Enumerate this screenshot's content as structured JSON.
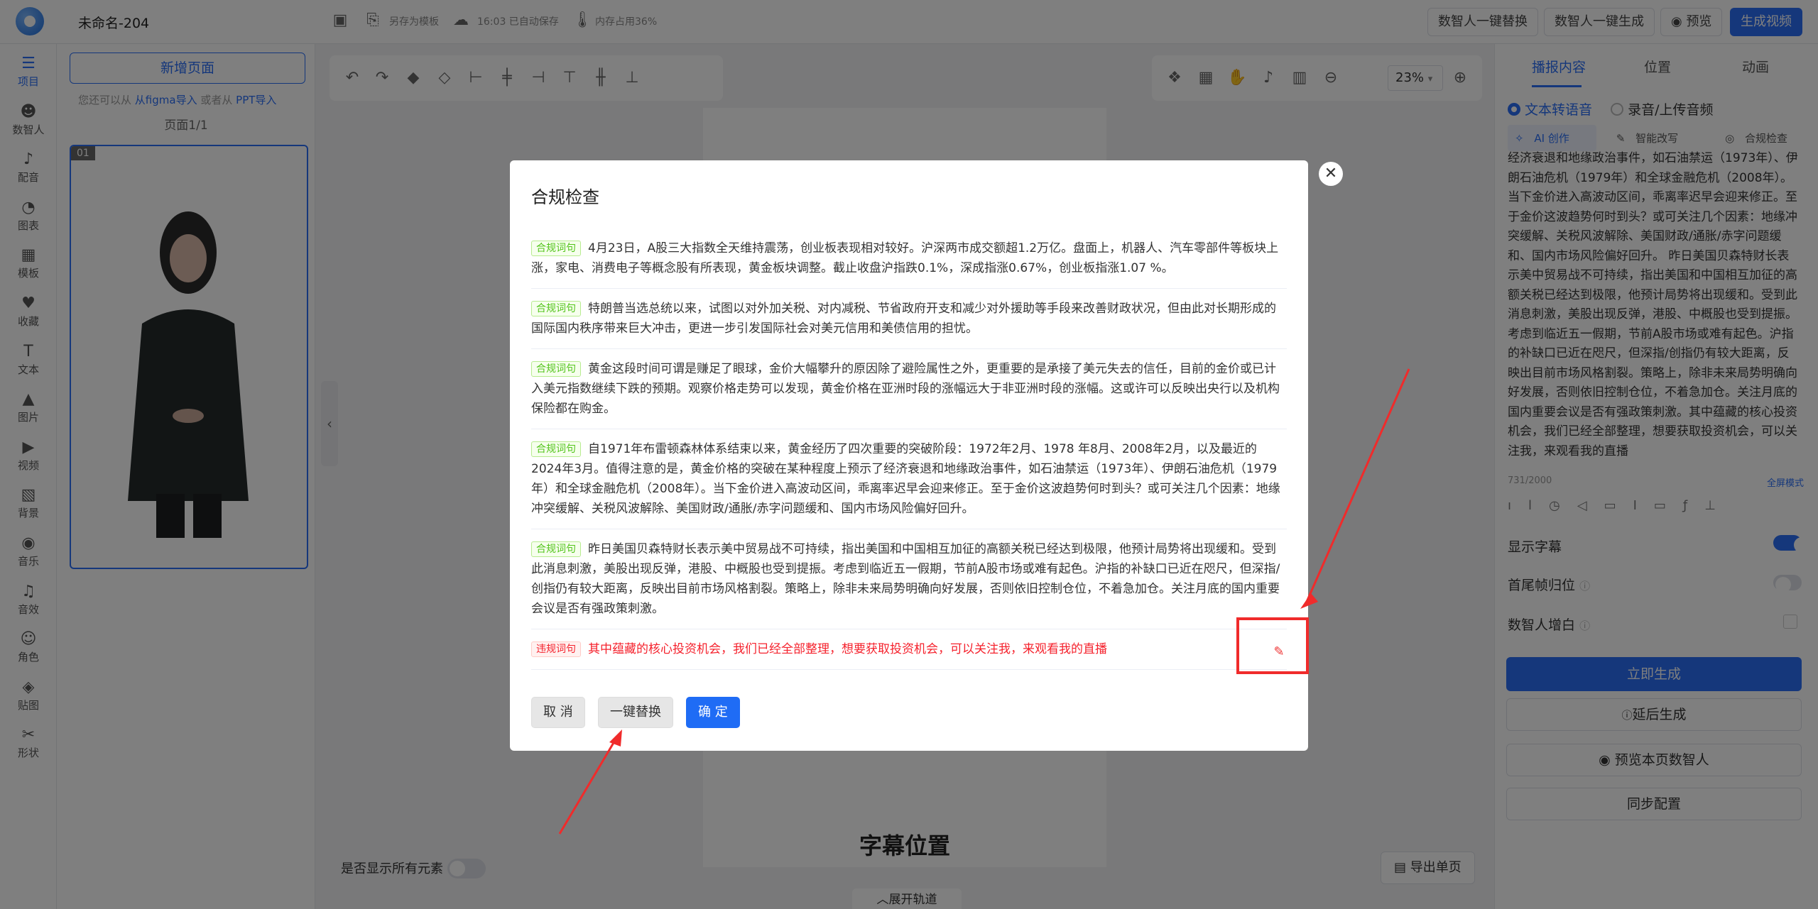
{
  "topbar": {
    "doc_title": "未命名-204",
    "save_as_template": "另存为模板",
    "autosave": "16:03 已自动保存",
    "memory": "内存占用36%",
    "btn_replace": "数智人一键替换",
    "btn_generate": "数智人一键生成",
    "btn_preview": "预览",
    "btn_make_video": "生成视频"
  },
  "sidebar": {
    "items": [
      {
        "label": "项目",
        "icon": "layers-icon",
        "glyph": "☰"
      },
      {
        "label": "数智人",
        "icon": "digital-human-icon",
        "glyph": "☻"
      },
      {
        "label": "配音",
        "icon": "dubbing-icon",
        "glyph": "♪"
      },
      {
        "label": "图表",
        "icon": "chart-icon",
        "glyph": "◔"
      },
      {
        "label": "模板",
        "icon": "template-icon",
        "glyph": "▦"
      },
      {
        "label": "收藏",
        "icon": "heart-icon",
        "glyph": "♥"
      },
      {
        "label": "文本",
        "icon": "text-icon",
        "glyph": "T"
      },
      {
        "label": "图片",
        "icon": "image-icon",
        "glyph": "▲"
      },
      {
        "label": "视频",
        "icon": "video-icon",
        "glyph": "▶"
      },
      {
        "label": "背景",
        "icon": "background-icon",
        "glyph": "▧"
      },
      {
        "label": "音乐",
        "icon": "music-icon",
        "glyph": "◉"
      },
      {
        "label": "音效",
        "icon": "sound-effect-icon",
        "glyph": "♫"
      },
      {
        "label": "角色",
        "icon": "role-icon",
        "glyph": "☺"
      },
      {
        "label": "贴图",
        "icon": "sticker-icon",
        "glyph": "◈"
      },
      {
        "label": "形状",
        "icon": "shape-icon",
        "glyph": "✂"
      }
    ]
  },
  "pages": {
    "new_page": "新增页面",
    "import_prefix": "您还可以从",
    "figma": "从figma导入",
    "or_from": "或者从",
    "ppt": "PPT导入",
    "page_count": "页面1/1",
    "thumb_num": "01"
  },
  "canvas": {
    "zoom": "23%",
    "subtitle_position": "字幕位置",
    "show_all": "是否显示所有元素",
    "export_page": "导出单页",
    "expand_track": "展开轨道"
  },
  "right": {
    "tabs": [
      "播报内容",
      "位置",
      "动画"
    ],
    "mode_tts": "文本转语音",
    "mode_record": "录音/上传音频",
    "ai_create": "AI 创作",
    "smart_rewrite": "智能改写",
    "compliance": "合规检查",
    "text": "经济衰退和地缘政治事件，如石油禁运（1973年）、伊朗石油危机（1979年）和全球金融危机（2008年）。当下金价进入高波动区间，乖离率迟早会迎来修正。至于金价这波趋势何时到头？或可关注几个因素：地缘冲突缓解、关税风波解除、美国财政/通胀/赤字问题缓和、国内市场风险偏好回升。 昨日美国贝森特财长表示美中贸易战不可持续，指出美国和中国相互加征的高额关税已经达到极限，他预计局势将出现缓和。受到此消息刺激，美股出现反弹，港股、中概股也受到提振。考虑到临近五一假期，节前A股市场或难有起色。沪指的补缺口已近在咫尺，但深指/创指仍有较大距离，反映出目前市场风格割裂。策略上，除非未来局势明确向好发展，否则依旧控制仓位，不着急加仓。关注月底的国内重要会议是否有强政策刺激。其中蕴藏的核心投资机会，我们已经全部整理，想要获取投资机会，可以关注我，来观看我的直播",
    "char_count": "731/2000",
    "full_mode": "全屏模式",
    "show_subtitle": "显示字幕",
    "head_tail_frame": "首尾帧归位",
    "human_white": "数智人增白",
    "btn_generate_now": "立即生成",
    "btn_delay": "延后生成",
    "btn_preview_human": "预览本页数智人",
    "btn_sync": "同步配置"
  },
  "modal": {
    "title": "合规检查",
    "items": [
      {
        "tag": "合规词句",
        "status": "ok",
        "text": "4月23日，A股三大指数全天维持震荡，创业板表现相对较好。沪深两市成交额超1.2万亿。盘面上，机器人、汽车零部件等板块上涨，家电、消费电子等概念股有所表现，黄金板块调整。截止收盘沪指跌0.1%，深成指涨0.67%，创业板指涨1.07 %。"
      },
      {
        "tag": "合规词句",
        "status": "ok",
        "text": "特朗普当选总统以来，试图以对外加关税、对内减税、节省政府开支和减少对外援助等手段来改善财政状况，但由此对长期形成的国际国内秩序带来巨大冲击，更进一步引发国际社会对美元信用和美债信用的担忧。"
      },
      {
        "tag": "合规词句",
        "status": "ok",
        "text": "黄金这段时间可谓是赚足了眼球，金价大幅攀升的原因除了避险属性之外，更重要的是承接了美元失去的信任，目前的金价或已计入美元指数继续下跌的预期。观察价格走势可以发现，黄金价格在亚洲时段的涨幅远大于非亚洲时段的涨幅。这或许可以反映出央行以及机构保险都在购金。"
      },
      {
        "tag": "合规词句",
        "status": "ok",
        "text": "自1971年布雷顿森林体系结束以来，黄金经历了四次重要的突破阶段：1972年2月、1978 年8月、2008年2月，以及最近的2024年3月。值得注意的是，黄金价格的突破在某种程度上预示了经济衰退和地缘政治事件，如石油禁运（1973年）、伊朗石油危机（1979年）和全球金融危机（2008年）。当下金价进入高波动区间，乖离率迟早会迎来修正。至于金价这波趋势何时到头？或可关注几个因素：地缘冲突缓解、关税风波解除、美国财政/通胀/赤字问题缓和、国内市场风险偏好回升。"
      },
      {
        "tag": "合规词句",
        "status": "ok",
        "text": "昨日美国贝森特财长表示美中贸易战不可持续，指出美国和中国相互加征的高额关税已经达到极限，他预计局势将出现缓和。受到此消息刺激，美股出现反弹，港股、中概股也受到提振。考虑到临近五一假期，节前A股市场或难有起色。沪指的补缺口已近在咫尺，但深指/创指仍有较大距离，反映出目前市场风格割裂。策略上，除非未来局势明确向好发展，否则依旧控制仓位，不着急加仓。关注月底的国内重要会议是否有强政策刺激。"
      },
      {
        "tag": "违规词句",
        "status": "violation",
        "text": "其中蕴藏的核心投资机会，我们已经全部整理，想要获取投资机会，可以关注我，来观看我的直播"
      }
    ],
    "btn_cancel": "取 消",
    "btn_replace_all": "一键替换",
    "btn_confirm": "确 定"
  },
  "colors": {
    "accent": "#2b6ff7",
    "ok": "#52c41a",
    "violation": "#f5222d",
    "annotation": "#f02b2b"
  }
}
